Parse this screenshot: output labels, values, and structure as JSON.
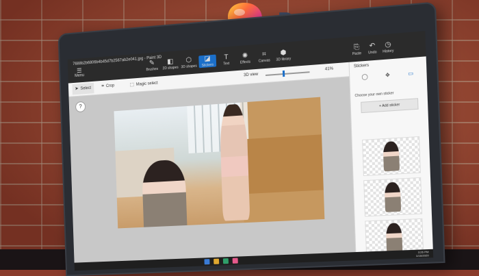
{
  "brand": {
    "title": "Paint 3D"
  },
  "window": {
    "filename": "7688b2b6806b4b45d7b2567ab2e041.jpg - Paint 3D"
  },
  "toolbar": {
    "menu_label": "Menu",
    "tools": [
      {
        "label": "Brushes",
        "icon": "brush-icon"
      },
      {
        "label": "2D shapes",
        "icon": "2d-shapes-icon"
      },
      {
        "label": "3D shapes",
        "icon": "3d-shapes-icon"
      },
      {
        "label": "Stickers",
        "icon": "stickers-icon",
        "active": true
      },
      {
        "label": "Text",
        "icon": "text-icon"
      },
      {
        "label": "Effects",
        "icon": "effects-icon"
      },
      {
        "label": "Canvas",
        "icon": "canvas-icon"
      },
      {
        "label": "3D library",
        "icon": "3d-library-icon"
      }
    ],
    "right_tools": [
      {
        "label": "Paste",
        "icon": "paste-icon"
      },
      {
        "label": "Undo",
        "icon": "undo-icon"
      },
      {
        "label": "History",
        "icon": "history-icon"
      }
    ]
  },
  "commandbar": {
    "select_label": "Select",
    "crop_label": "Crop",
    "magic_label": "Magic select",
    "view3d_label": "3D view",
    "zoom_value": 41,
    "zoom_text": "41%"
  },
  "canvas": {
    "help_label": "?"
  },
  "panel": {
    "title": "Stickers",
    "subtitle": "Choose your own sticker",
    "add_label": "Add sticker"
  },
  "taskbar": {
    "time": "3:26 PM",
    "date": "1/16/2020"
  },
  "colors": {
    "accent": "#1b6fc9",
    "titlebar": "#2b2b2b",
    "brick": "#9c4431"
  }
}
